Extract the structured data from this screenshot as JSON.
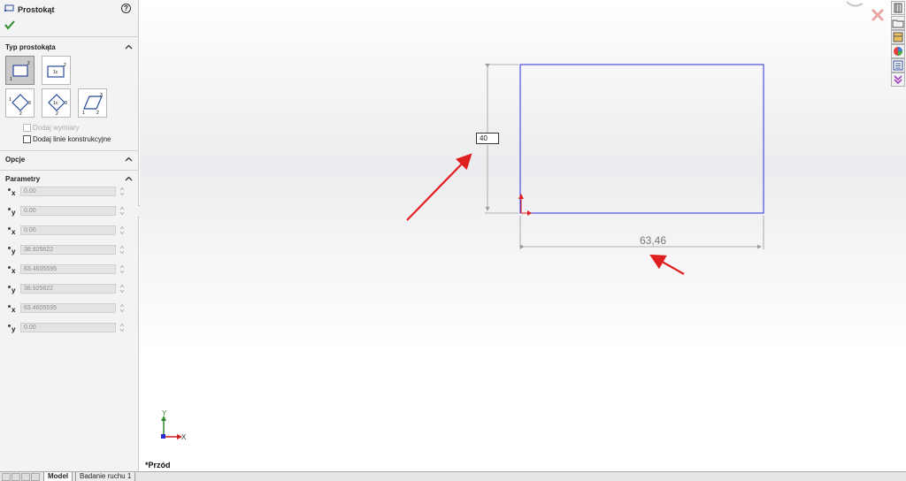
{
  "property_manager": {
    "title": "Prostokąt",
    "help_icon": "?",
    "sections": {
      "rect_type": "Typ prostokąta",
      "options": "Opcje",
      "parameters": "Parametry"
    },
    "rect_types": [
      {
        "name": "corner-rectangle",
        "selected": true
      },
      {
        "name": "center-rectangle",
        "selected": false
      },
      {
        "name": "3-point-corner-rectangle",
        "selected": false
      },
      {
        "name": "3-point-center-rectangle",
        "selected": false
      },
      {
        "name": "parallelogram",
        "selected": false
      }
    ],
    "checkboxes": {
      "add_dimensions": "Dodaj wymiary",
      "add_construction_lines": "Dodaj linie konstrukcyjne"
    },
    "parameters": [
      {
        "axis": "x",
        "value": "0.00"
      },
      {
        "axis": "y",
        "value": "0.00"
      },
      {
        "axis": "x",
        "value": "0.00"
      },
      {
        "axis": "y",
        "value": "38.925622"
      },
      {
        "axis": "x",
        "value": "63.4605595"
      },
      {
        "axis": "y",
        "value": "38.925622"
      },
      {
        "axis": "x",
        "value": "63.4605595"
      },
      {
        "axis": "y",
        "value": "0.00"
      }
    ]
  },
  "canvas": {
    "dimension_input": "40",
    "width_dimension": "63,46",
    "view_name": "*Przód",
    "triad": {
      "x": "X",
      "y": "Y"
    }
  },
  "colors": {
    "sketch_line": "#2b2bd8",
    "annotation_arrow": "#e02020",
    "accept": "#2e8b2e"
  },
  "tabs": {
    "model": "Model",
    "motion_study": "Badanie ruchu 1"
  }
}
